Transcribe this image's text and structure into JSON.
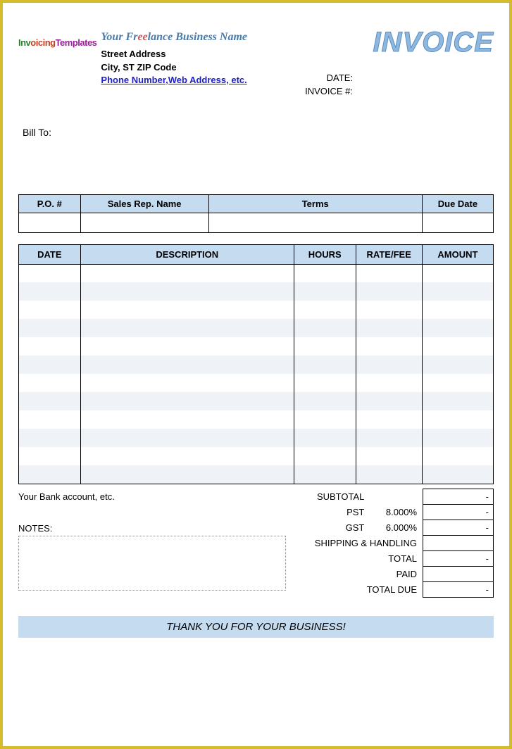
{
  "header": {
    "logo_text_inv": "Inv",
    "logo_text_oic": "oicing",
    "logo_text_temp": "Templates",
    "biz_name_1": "Your Fr",
    "biz_name_2": "ee",
    "biz_name_3": "lance Business Name",
    "addr1": "Street Address",
    "addr2": "City, ST  ZIP Code",
    "contact": "Phone Number,Web Address, etc.",
    "invoice_title": "INVOICE",
    "date_label": "DATE:",
    "invoice_num_label": "INVOICE #:"
  },
  "bill_to_label": "Bill To:",
  "info_headers": {
    "po": "P.O. #",
    "rep": "Sales Rep. Name",
    "terms": "Terms",
    "due": "Due Date"
  },
  "item_headers": {
    "date": "DATE",
    "desc": "DESCRIPTION",
    "hours": "HOURS",
    "rate": "RATE/FEE",
    "amount": "AMOUNT"
  },
  "totals": {
    "bank": "Your Bank account, etc.",
    "notes_label": "NOTES:",
    "subtotal_label": "SUBTOTAL",
    "pst_label": "PST",
    "pst_rate": "8.000%",
    "gst_label": "GST",
    "gst_rate": "6.000%",
    "ship_label": "SHIPPING & HANDLING",
    "total_label": "TOTAL",
    "paid_label": "PAID",
    "due_label": "TOTAL DUE",
    "dash": "-"
  },
  "thank_you": "THANK YOU FOR YOUR BUSINESS!"
}
